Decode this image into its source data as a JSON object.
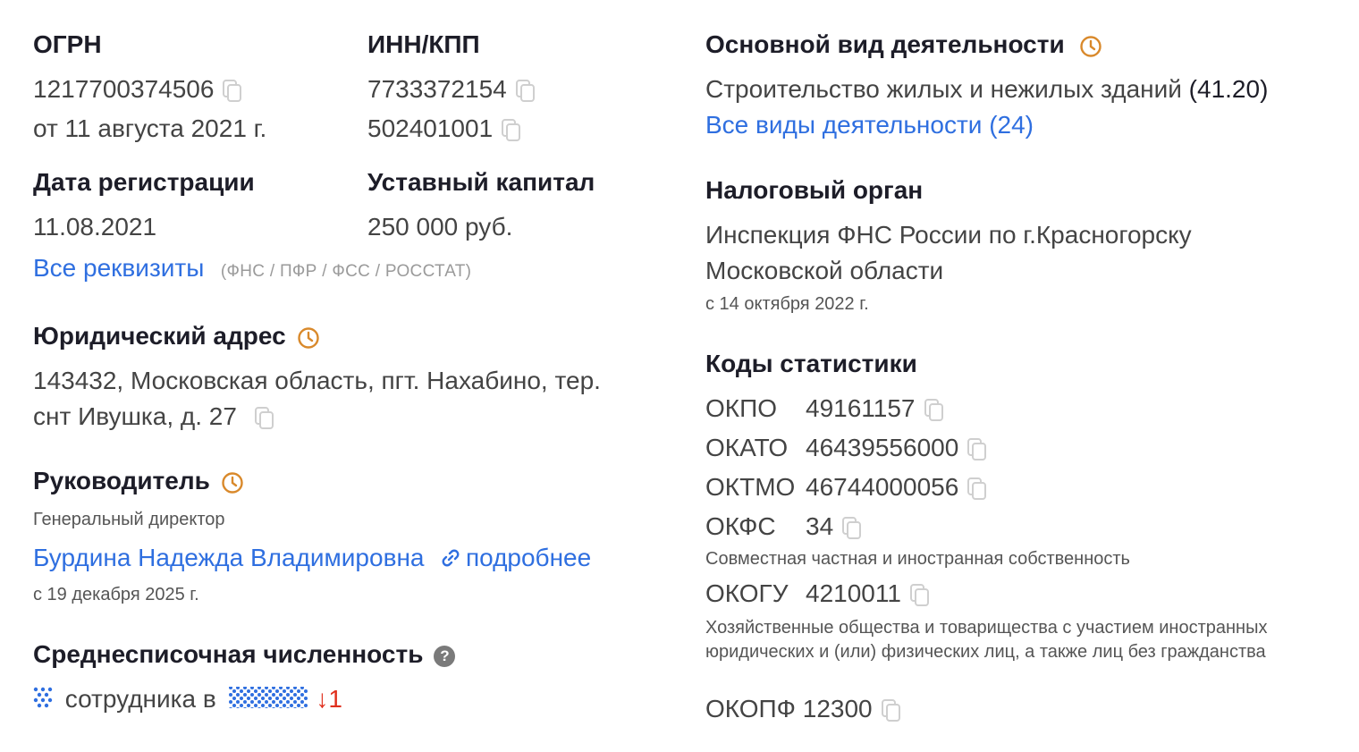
{
  "ogrn": {
    "title": "ОГРН",
    "value": "1217700374506",
    "date": "от 11 августа 2021 г."
  },
  "inn_kpp": {
    "title": "ИНН/КПП",
    "inn": "7733372154",
    "kpp": "502401001"
  },
  "registration": {
    "title": "Дата регистрации",
    "value": "11.08.2021"
  },
  "capital": {
    "title": "Уставный капитал",
    "value": "250 000 руб."
  },
  "requisites": {
    "link": "Все реквизиты",
    "note": "(ФНС / ПФР / ФСС / РОССТАТ)"
  },
  "address": {
    "title": "Юридический адрес",
    "line1": "143432, Московская область, пгт. Нахабино, тер.",
    "line2": "снт Ивушка, д. 27"
  },
  "director": {
    "title": "Руководитель",
    "role": "Генеральный директор",
    "name": "Бурдина Надежда Владимировна",
    "more": "подробнее",
    "since": "с 19 декабря 2025 г."
  },
  "headcount": {
    "title": "Среднесписочная численность",
    "text1": "сотрудника в",
    "delta": "↓1"
  },
  "activity": {
    "title": "Основной вид деятельности",
    "value": "Строительство жилых и нежилых зданий",
    "code": "(41.20)",
    "all_link": "Все виды деятельности (24)"
  },
  "tax": {
    "title": "Налоговый орган",
    "line1": "Инспекция ФНС России по г.Красногорску",
    "line2": "Московской области",
    "since": "с 14 октября 2022 г."
  },
  "stats": {
    "title": "Коды статистики",
    "okpo": {
      "label": "ОКПО",
      "value": "49161157"
    },
    "okato": {
      "label": "ОКАТО",
      "value": "46439556000"
    },
    "oktmo": {
      "label": "ОКТМО",
      "value": "46744000056"
    },
    "okfs": {
      "label": "ОКФС",
      "value": "34",
      "desc": "Совместная частная и иностранная собственность"
    },
    "okogu": {
      "label": "ОКОГУ",
      "value": "4210011",
      "desc": "Хозяйственные общества и товарищества с участием иностранных юридических и (или) физических лиц, а также лиц без гражданства"
    },
    "okopf": {
      "label": "ОКОПФ",
      "value": "12300"
    }
  },
  "colors": {
    "link": "#2f6fe0",
    "clock": "#d9892b",
    "down": "#e0301e"
  },
  "icons": {
    "copy": "copy-icon",
    "clock": "clock-icon",
    "help": "question-icon",
    "link": "link-icon"
  }
}
